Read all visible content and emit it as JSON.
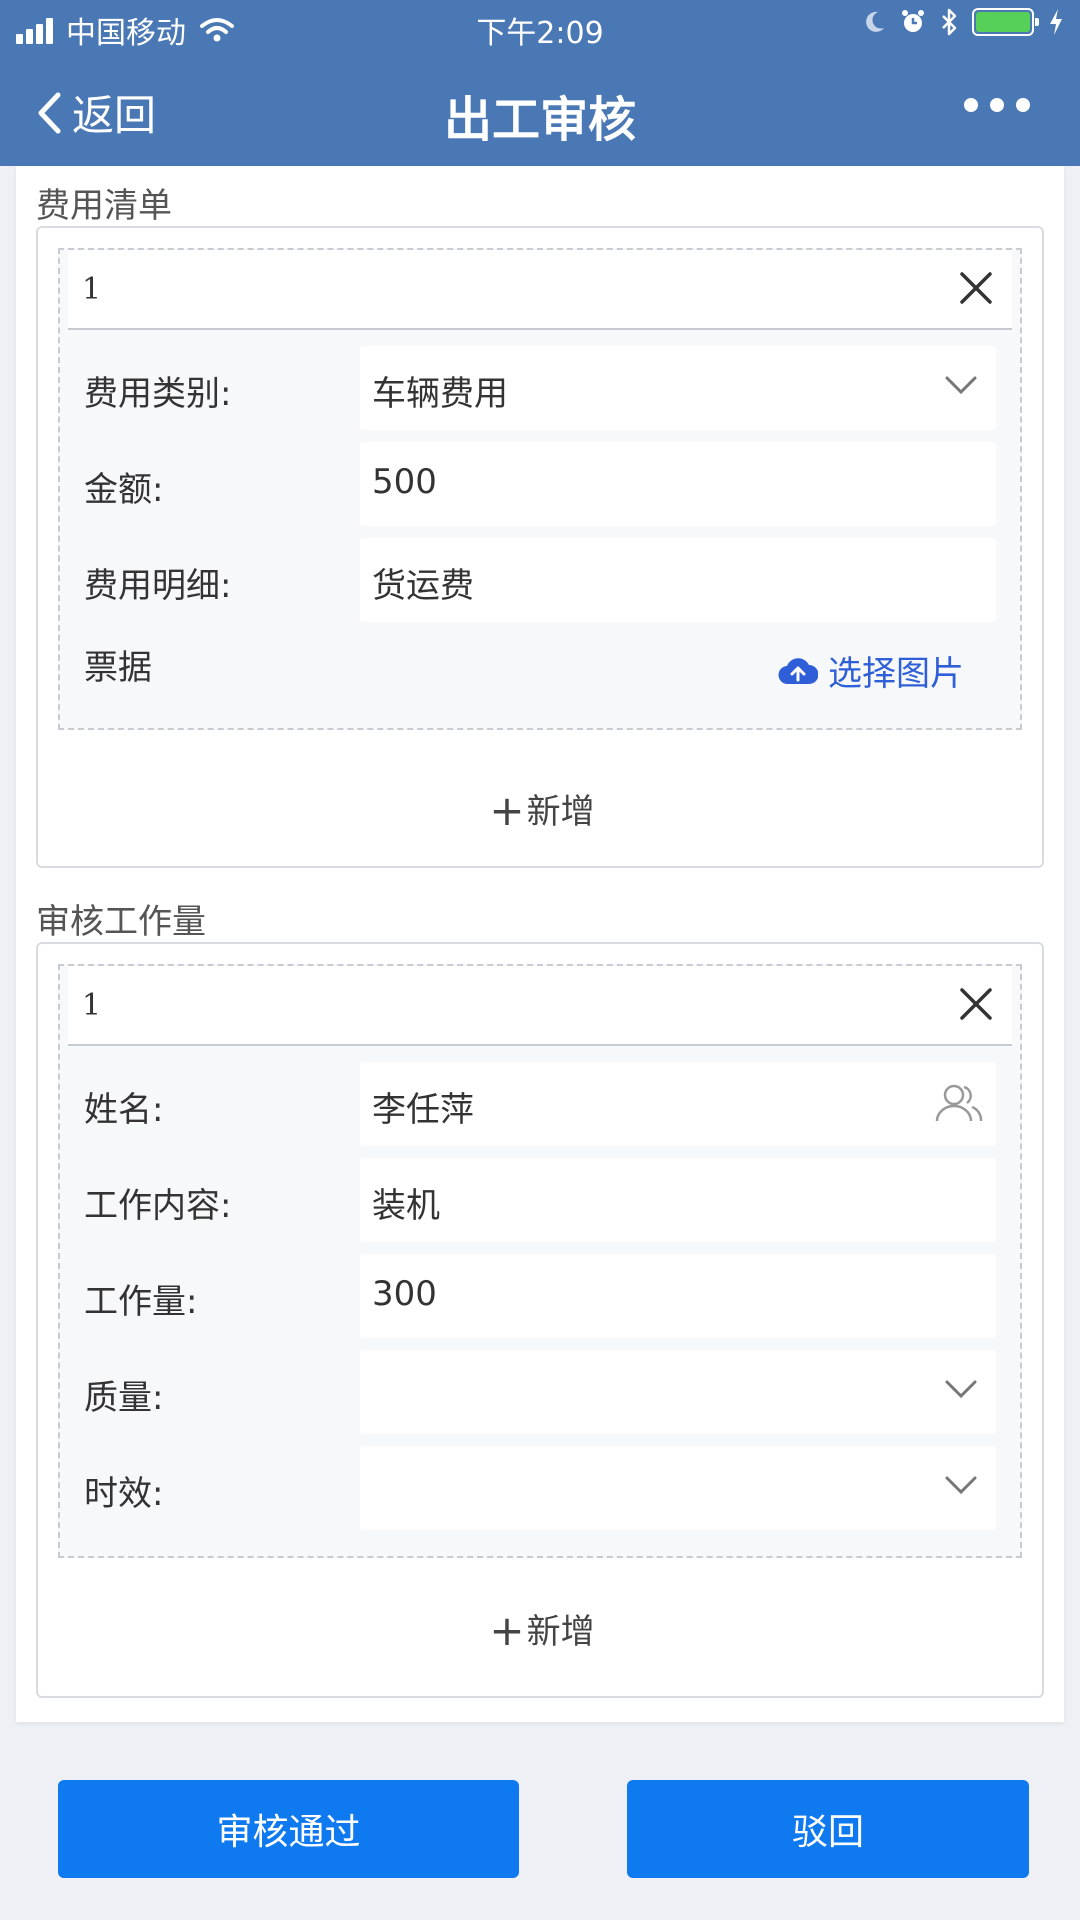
{
  "status_bar": {
    "carrier": "中国移动",
    "time": "下午2:09"
  },
  "nav": {
    "back_label": "返回",
    "title": "出工审核"
  },
  "expense": {
    "section_title": "费用清单",
    "item": {
      "index": "1",
      "fields": [
        {
          "label": "费用类别:",
          "value": "车辆费用"
        },
        {
          "label": "金额:",
          "value": "500"
        },
        {
          "label": "费用明细:",
          "value": "货运费"
        }
      ],
      "receipt_label": "票据",
      "upload_label": "选择图片"
    },
    "add_label": "新增"
  },
  "workload": {
    "section_title": "审核工作量",
    "item": {
      "index": "1",
      "fields": [
        {
          "label": "姓名:",
          "value": "李任萍"
        },
        {
          "label": "工作内容:",
          "value": "装机"
        },
        {
          "label": "工作量:",
          "value": "300"
        },
        {
          "label": "质量:",
          "value": ""
        },
        {
          "label": "时效:",
          "value": ""
        }
      ]
    },
    "add_label": "新增"
  },
  "actions": {
    "approve_label": "审核通过",
    "reject_label": "驳回"
  },
  "colors": {
    "header": "#4a78b5",
    "primary_button": "#0f7af0",
    "link": "#2f5fd8"
  }
}
